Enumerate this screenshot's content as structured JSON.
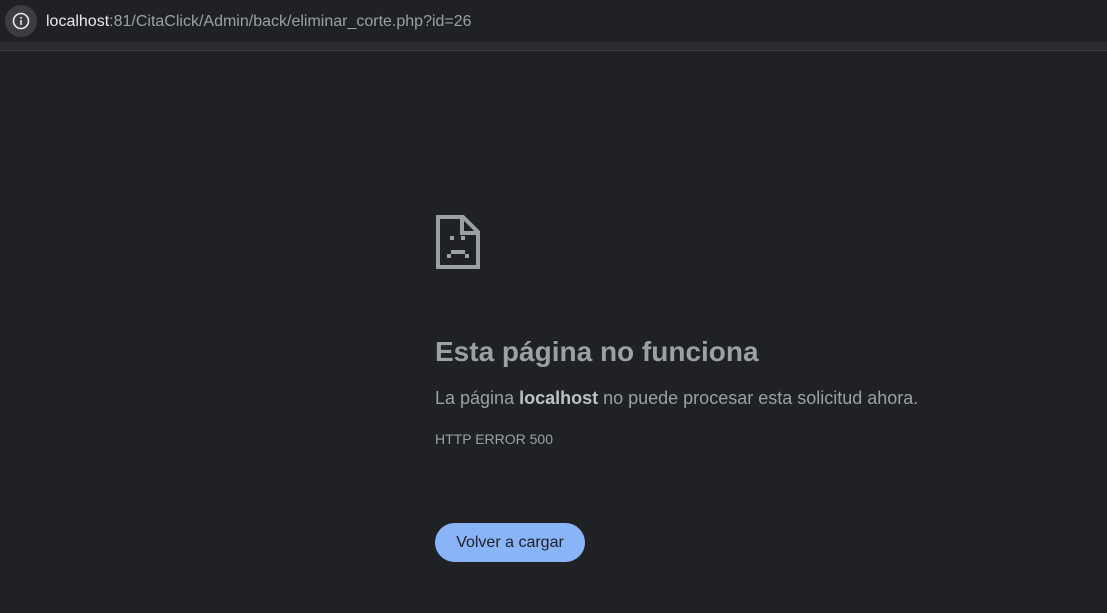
{
  "browser": {
    "address_bar": {
      "host": "localhost",
      "path": ":81/CitaClick/Admin/back/eliminar_corte.php?id=26",
      "icon": "info-icon"
    }
  },
  "error_page": {
    "icon": "sad-page-icon",
    "title": "Esta página no funciona",
    "message_prefix": "La página ",
    "message_host": "localhost",
    "message_suffix": " no puede procesar esta solicitud ahora.",
    "error_code": "HTTP ERROR 500",
    "reload_label": "Volver a cargar"
  },
  "colors": {
    "background": "#202124",
    "text": "#9aa0a6",
    "accent": "#8ab4f8"
  }
}
